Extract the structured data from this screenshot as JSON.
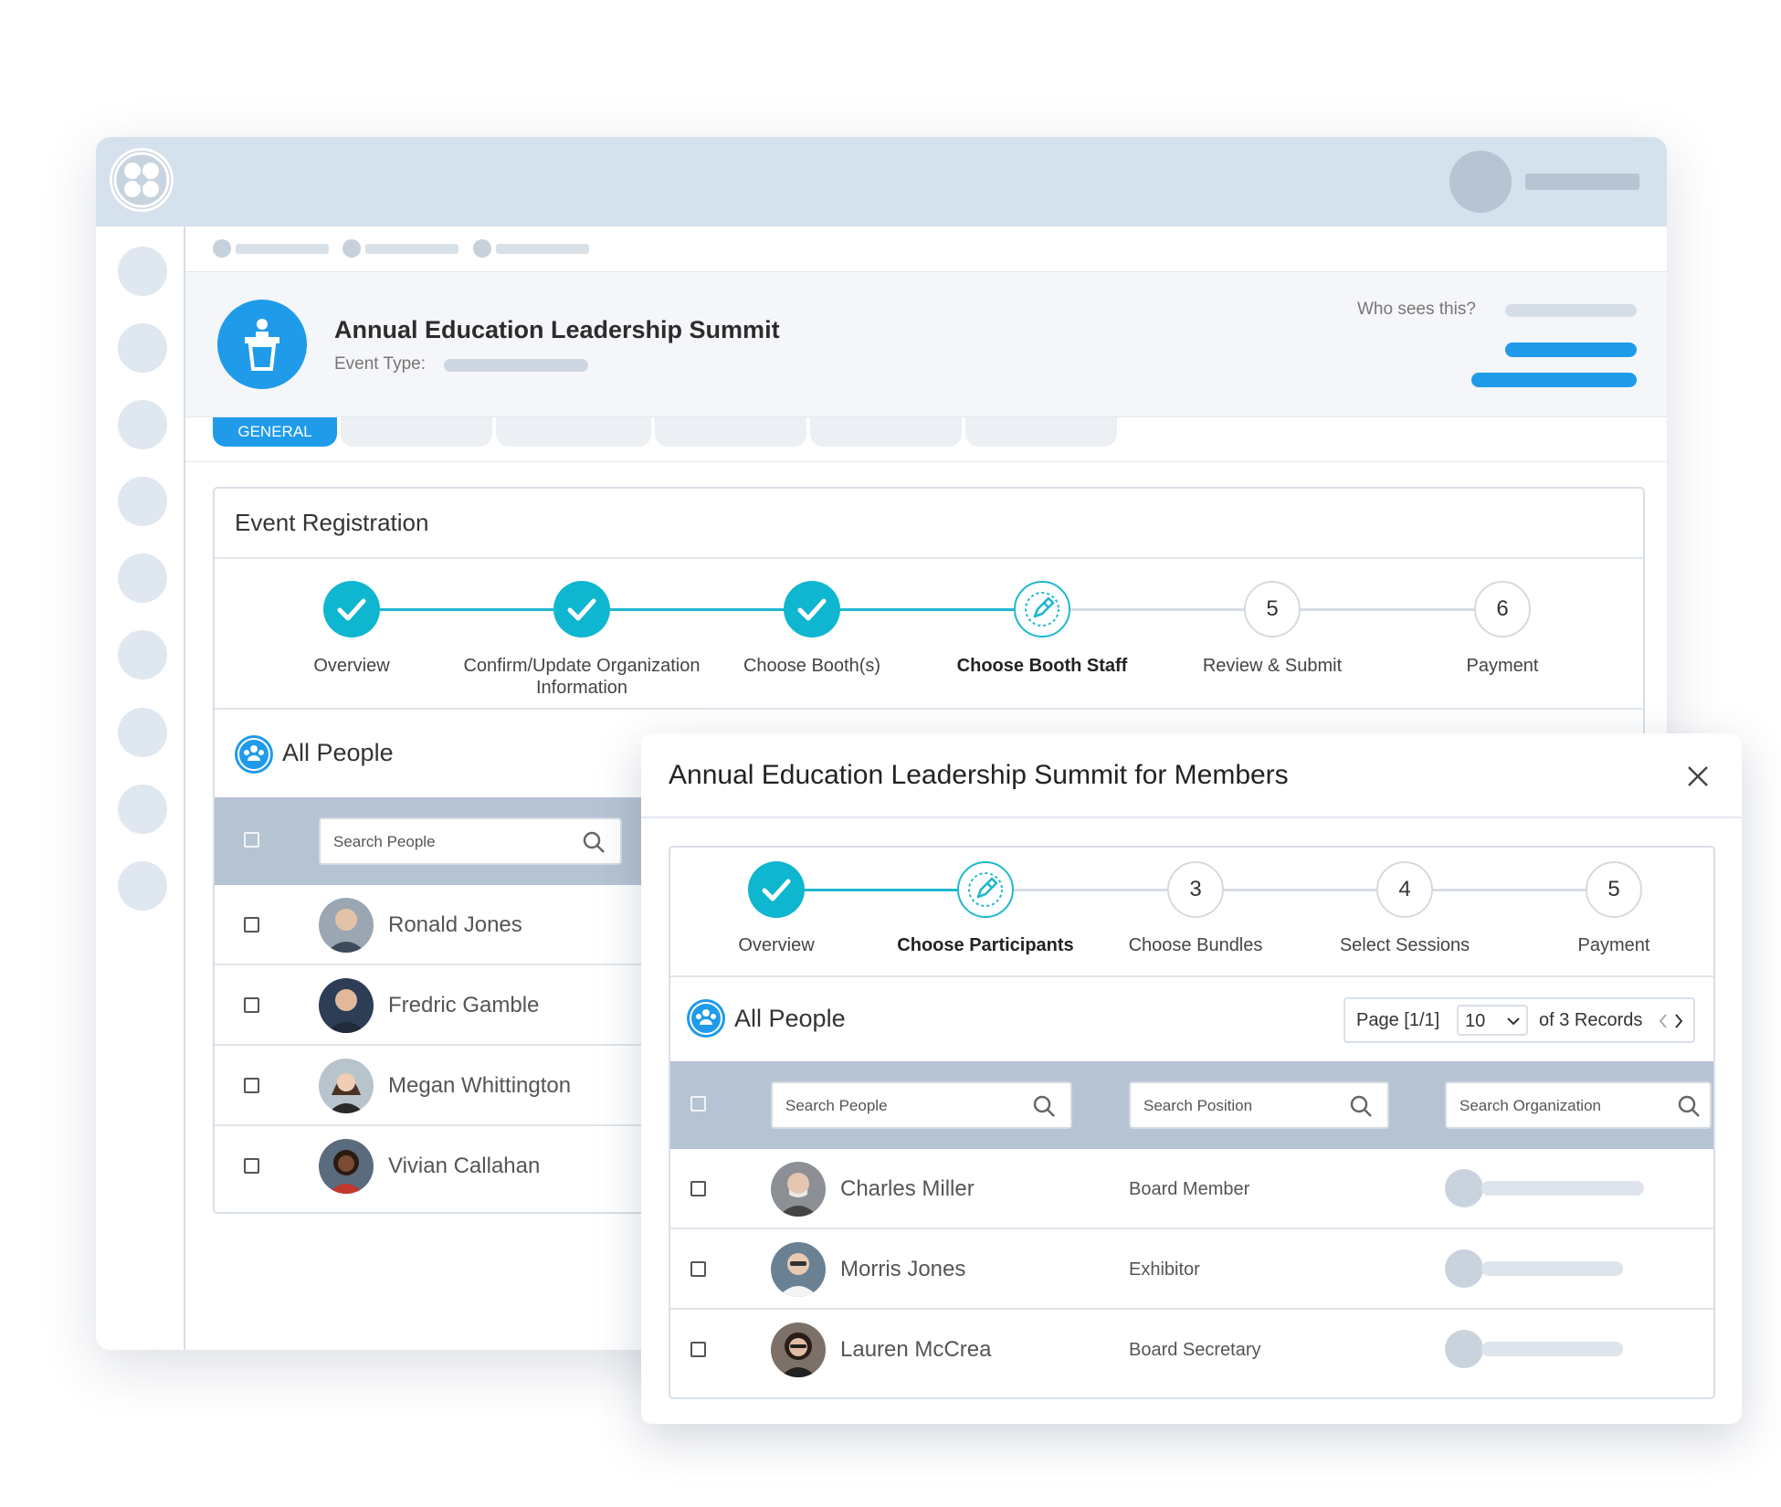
{
  "event": {
    "title": "Annual Education Leadership Summit",
    "event_type_label": "Event Type:",
    "who_sees_label": "Who sees this?"
  },
  "tabs": {
    "active": "GENERAL"
  },
  "registration": {
    "title": "Event Registration",
    "steps": [
      {
        "label": "Overview",
        "state": "done"
      },
      {
        "label": "Confirm/Update Organization Information",
        "state": "done"
      },
      {
        "label": "Choose Booth(s)",
        "state": "done"
      },
      {
        "label": "Choose Booth Staff",
        "state": "current"
      },
      {
        "label": "Review & Submit",
        "state": "todo",
        "number": "5"
      },
      {
        "label": "Payment",
        "state": "todo",
        "number": "6"
      }
    ],
    "people": {
      "title": "All People",
      "search_placeholder": "Search People",
      "rows": [
        {
          "name": "Ronald Jones"
        },
        {
          "name": "Fredric Gamble"
        },
        {
          "name": "Megan Whittington"
        },
        {
          "name": "Vivian Callahan"
        }
      ]
    }
  },
  "modal": {
    "title": "Annual Education Leadership Summit for Members",
    "steps": [
      {
        "label": "Overview",
        "state": "done"
      },
      {
        "label": "Choose Participants",
        "state": "current"
      },
      {
        "label": "Choose Bundles",
        "state": "todo",
        "number": "3"
      },
      {
        "label": "Select Sessions",
        "state": "todo",
        "number": "4"
      },
      {
        "label": "Payment",
        "state": "todo",
        "number": "5"
      }
    ],
    "people": {
      "title": "All People",
      "pager": {
        "page": "Page [1/1]",
        "per_page": "10",
        "records": "of 3 Records"
      },
      "search_people_placeholder": "Search People",
      "search_position_placeholder": "Search Position",
      "search_organization_placeholder": "Search Organization",
      "rows": [
        {
          "name": "Charles Miller",
          "position": "Board Member"
        },
        {
          "name": "Morris Jones",
          "position": "Exhibitor"
        },
        {
          "name": "Lauren McCrea",
          "position": "Board Secretary"
        }
      ]
    }
  },
  "colors": {
    "accent": "#1f9bea",
    "step_done": "#0fb6cf",
    "header_bg": "#d5e1ec",
    "table_head": "#b6c3d2"
  },
  "icons": [
    "logo-icon",
    "podium-icon",
    "check-icon",
    "edit-pencil-icon",
    "people-group-icon",
    "search-icon",
    "close-icon",
    "chevron-down-icon",
    "chevron-left-icon",
    "chevron-right-icon"
  ]
}
